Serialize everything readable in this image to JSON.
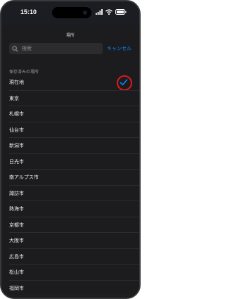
{
  "status_bar": {
    "time": "15:10",
    "icons": [
      "signal-icon",
      "wifi-icon",
      "battery-icon"
    ]
  },
  "sheet": {
    "title": "場所"
  },
  "search": {
    "placeholder": "検索",
    "value": "",
    "cancel_label": "キャンセル"
  },
  "section": {
    "header": "保存済みの場所"
  },
  "locations": [
    {
      "label": "現在地",
      "selected": true
    },
    {
      "label": "東京"
    },
    {
      "label": "札幌市"
    },
    {
      "label": "仙台市"
    },
    {
      "label": "新潟市"
    },
    {
      "label": "日光市"
    },
    {
      "label": "南アルプス市"
    },
    {
      "label": "諏訪市"
    },
    {
      "label": "熱海市"
    },
    {
      "label": "京都市"
    },
    {
      "label": "大阪市"
    },
    {
      "label": "広島市"
    },
    {
      "label": "松山市"
    },
    {
      "label": "福岡市"
    }
  ],
  "colors": {
    "accent": "#0a84ff",
    "highlight": "#e0191c",
    "background": "#1c1c1e"
  }
}
